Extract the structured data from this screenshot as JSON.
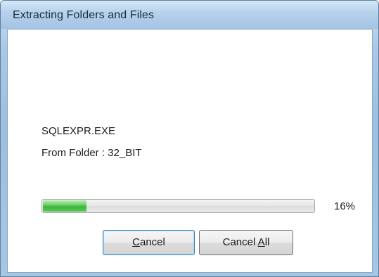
{
  "window": {
    "title": "Extracting Folders and Files"
  },
  "extract": {
    "file_name": "SQLEXPR.EXE",
    "from_folder": "From Folder : 32_BIT"
  },
  "progress": {
    "value": 0.16,
    "label": "16%"
  },
  "buttons": {
    "cancel": {
      "label": "Cancel",
      "accel": "C",
      "rest": "ancel"
    },
    "cancel_all": {
      "label": "Cancel All",
      "prefix": "Cancel ",
      "accel": "A",
      "rest": "ll"
    }
  },
  "colors": {
    "progress_fill": "#3fb73d",
    "titlebar": "#b7d2ec"
  }
}
